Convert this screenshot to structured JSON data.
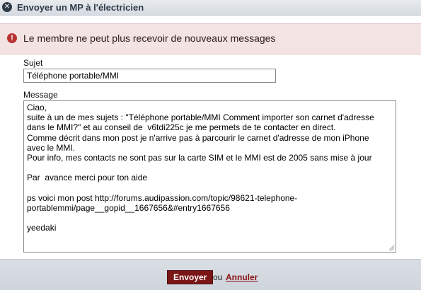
{
  "window": {
    "title": "Envoyer un MP à l'électricien",
    "close_icon": "close-icon"
  },
  "error": {
    "message": "Le membre ne peut plus recevoir de nouveaux messages",
    "icon": "exclamation-icon",
    "background_color": "#f4e3e3"
  },
  "form": {
    "subject_label": "Sujet",
    "subject_value": "Téléphone portable/MMI",
    "message_label": "Message",
    "message_lines": [
      "Ciao,",
      "suite à un de mes sujets : \"Téléphone portable/MMI Comment importer son carnet d'adresse",
      "dans le MMI?\" et au conseil de  v6tdi225c je me permets de te contacter en direct.",
      "Comme décrit dans mon post je n'arrive pas à parcourir le carnet d'adresse de mon iPhone",
      "avec le MMI.",
      "Pour info, mes contacts ne sont pas sur la carte SIM et le MMI est de 2005 sans mise à jour",
      "",
      "Par  avance merci pour ton aide",
      "",
      "ps voici mon post http://forums.audipassion.com/topic/98621-telephone-",
      "portablemmi/page__gopid__1667656&#entry1667656",
      "",
      "yeedaki"
    ]
  },
  "footer": {
    "send_label": "Envoyer",
    "or_text": "ou",
    "cancel_label": "Annuler",
    "accent_color": "#7a1616"
  }
}
